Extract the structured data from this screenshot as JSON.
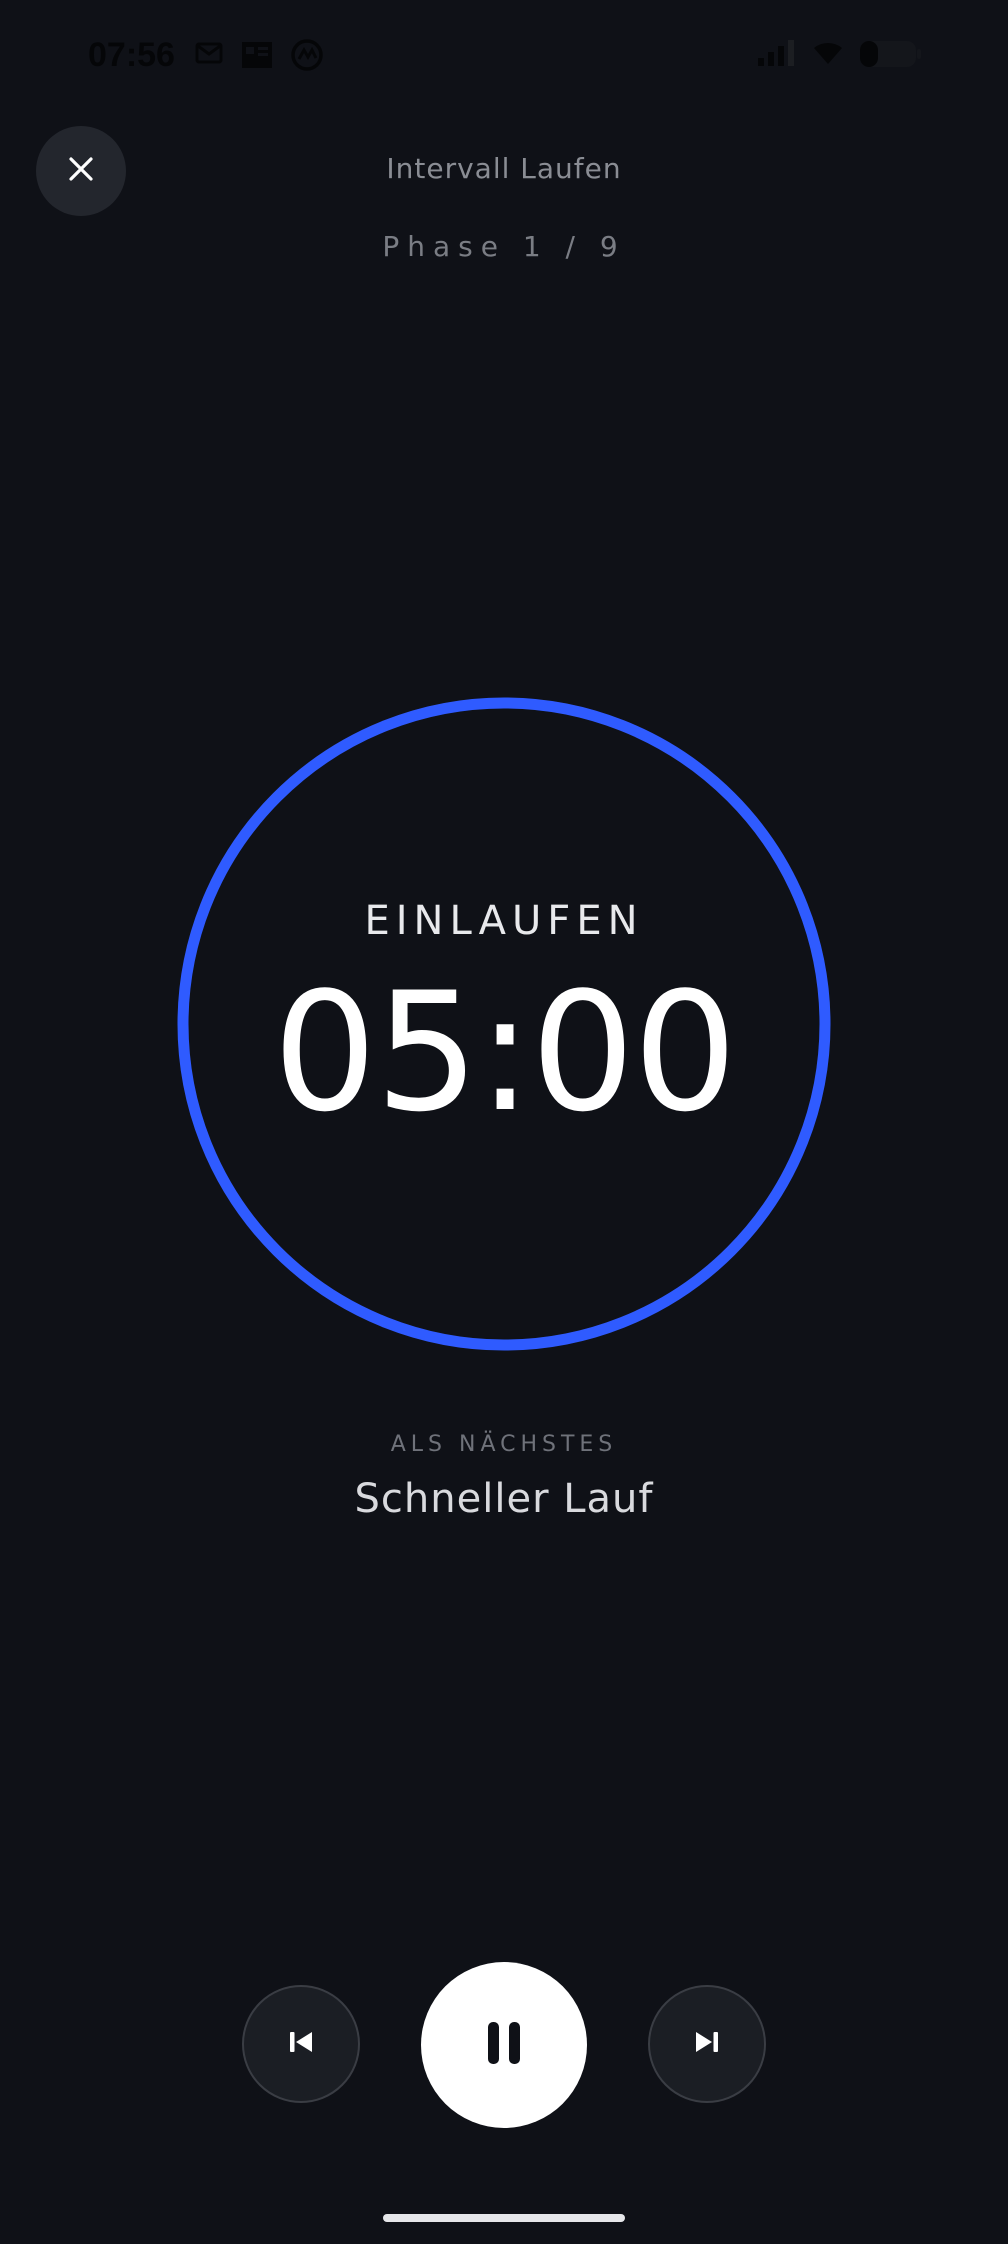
{
  "status_bar": {
    "time": "07:56",
    "icons": [
      "mail-icon",
      "news-icon",
      "app-icon",
      "signal-icon",
      "wifi-icon",
      "battery-icon"
    ]
  },
  "header": {
    "close_icon": "close-icon",
    "title": "Intervall Laufen",
    "phase": "Phase 1 / 9"
  },
  "timer": {
    "phase_name": "EINLAUFEN",
    "remaining": "05:00",
    "ring_color": "#2f5bff",
    "progress": 1.0
  },
  "up_next": {
    "label": "ALS NÄCHSTES",
    "name": "Schneller Lauf"
  },
  "controls": {
    "previous_icon": "skip-previous-icon",
    "pause_icon": "pause-icon",
    "next_icon": "skip-next-icon"
  },
  "colors": {
    "background": "#0f1117",
    "accent": "#2f5bff"
  }
}
